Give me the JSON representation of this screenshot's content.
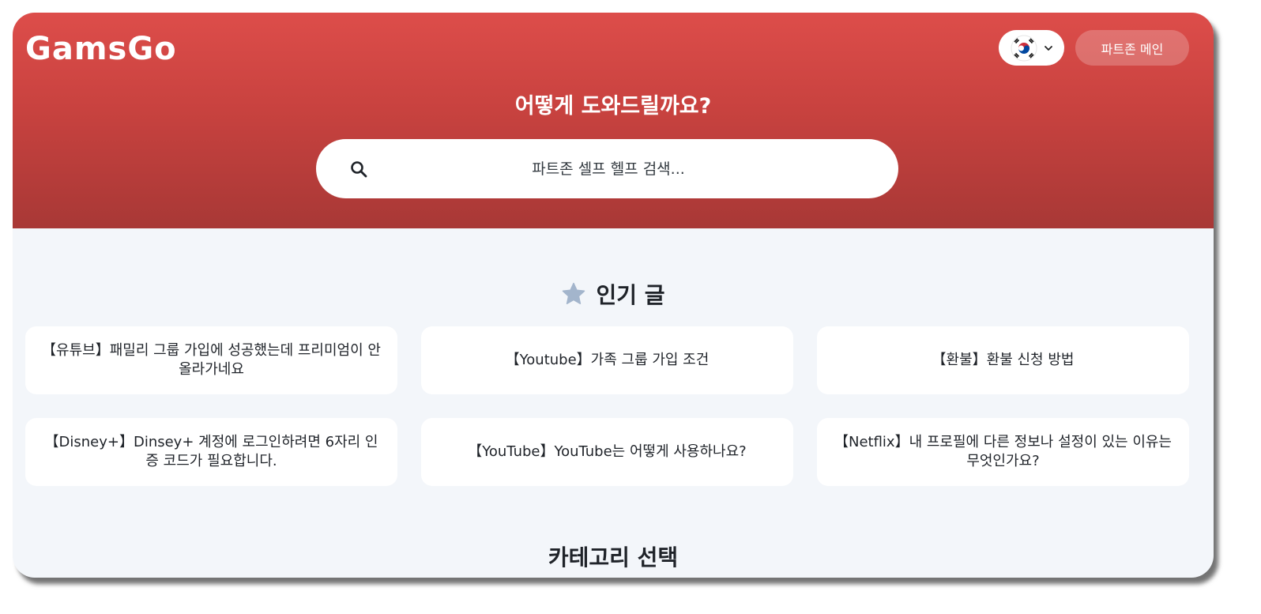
{
  "header": {
    "logo_text": "GamsGo",
    "language": {
      "icon": "korea-flag-icon"
    },
    "partner_main_label": "파트존 메인"
  },
  "hero": {
    "title": "어떻게 도와드릴까요?",
    "search": {
      "placeholder": "파트존 셀프 헬프 검색..."
    }
  },
  "popular": {
    "title": "인기 글",
    "articles": [
      "【유튜브】패밀리 그룹 가입에 성공했는데 프리미엄이 안 올라가네요",
      "【Youtube】가족 그룹 가입 조건",
      "【환불】환불 신청 방법",
      "【Disney+】Dinsey+ 계정에 로그인하려면 6자리 인증 코드가 필요합니다.",
      "【YouTube】YouTube는 어떻게 사용하나요?",
      "【Netflix】내 프로필에 다른 정보나 설정이 있는 이유는 무엇인가요?"
    ]
  },
  "categories": {
    "title": "카테고리 선택"
  },
  "colors": {
    "brand_red": "#dd4d4a",
    "brand_red_dark": "#a83836",
    "page_bg": "#f3f6fa",
    "star": "#a3b5cc"
  }
}
